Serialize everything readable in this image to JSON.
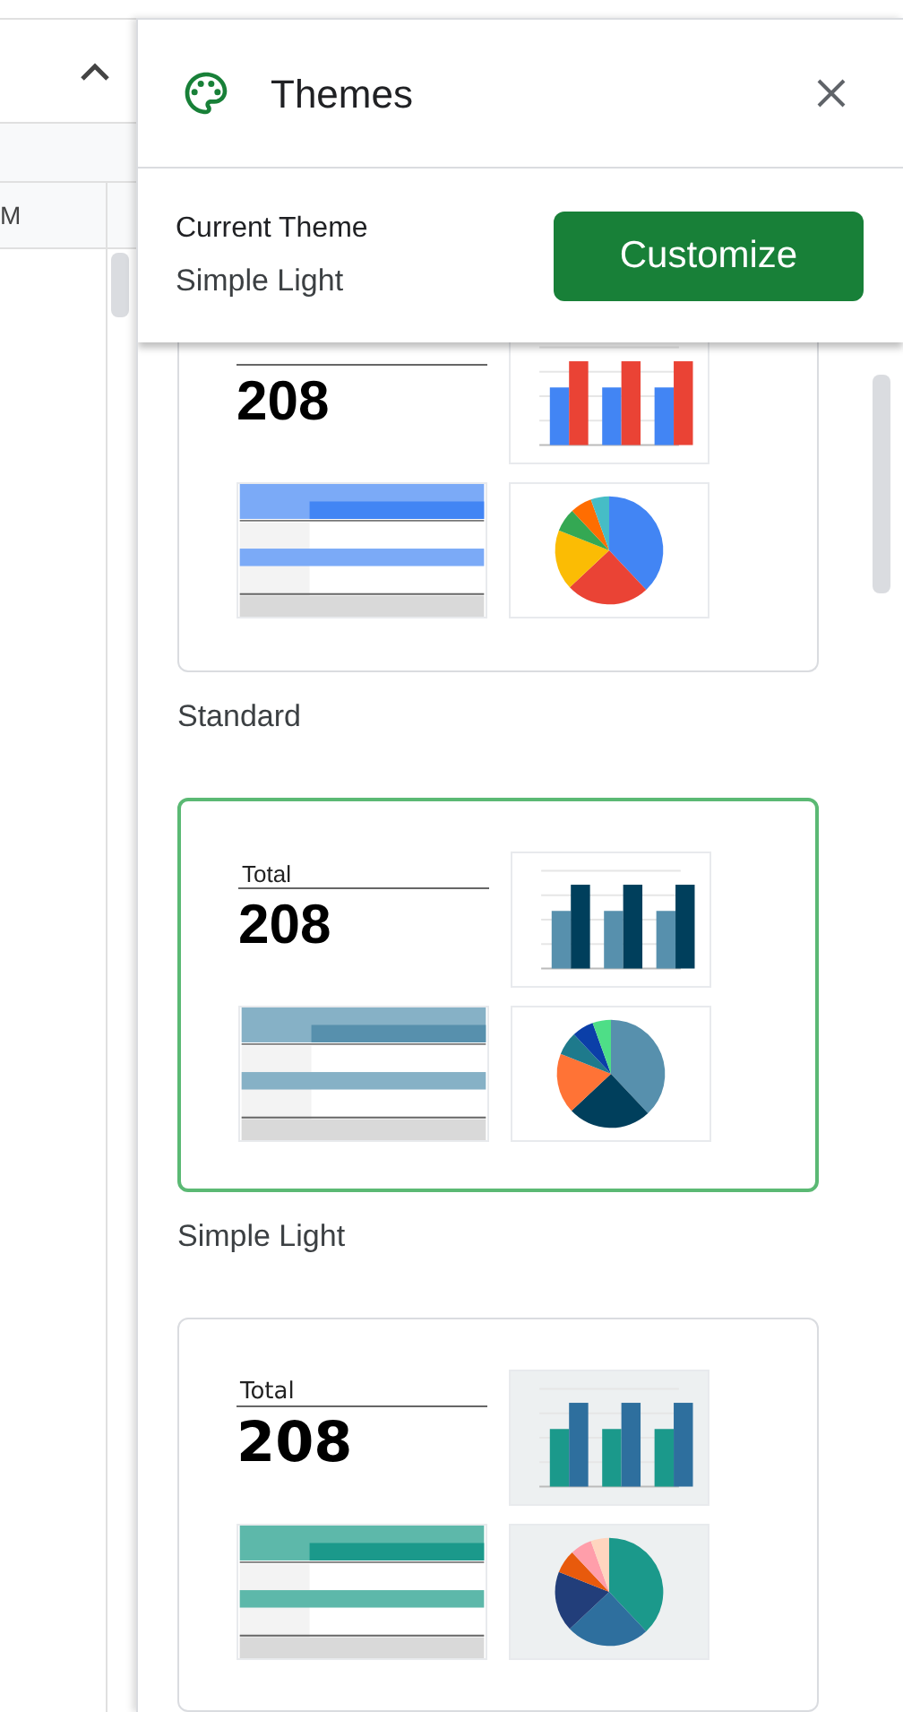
{
  "sheet": {
    "column_header": "M"
  },
  "panel": {
    "title": "Themes"
  },
  "current": {
    "label": "Current Theme",
    "name": "Simple Light",
    "button": "Customize"
  },
  "themes": [
    {
      "kind": "standard",
      "name": "Standard",
      "selected": false,
      "total": "208"
    },
    {
      "kind": "light",
      "name": "Simple Light",
      "selected": true,
      "total_label": "Total",
      "total": "208"
    },
    {
      "kind": "dark",
      "selected": false,
      "total_label": "Total",
      "total": "208"
    }
  ]
}
